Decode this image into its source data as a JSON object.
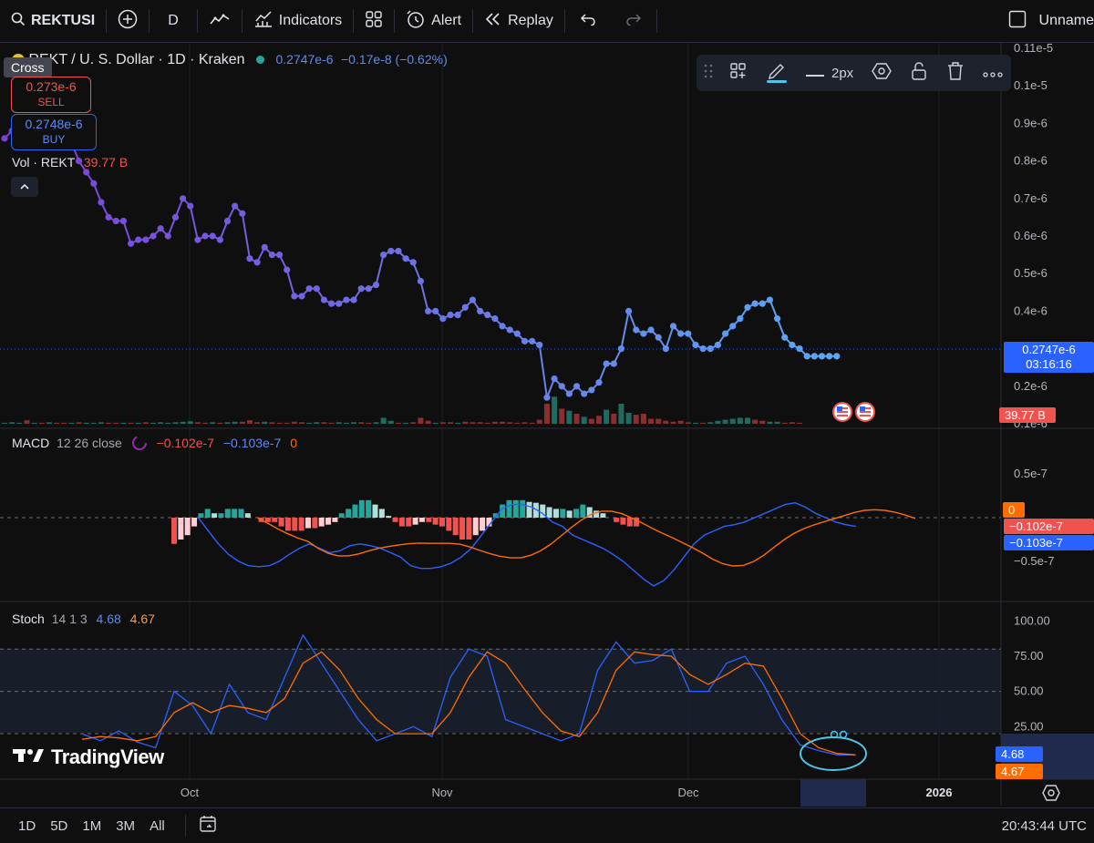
{
  "toolbar": {
    "symbol": "REKTUSI",
    "interval": "D",
    "indicators_label": "Indicators",
    "alert_label": "Alert",
    "replay_label": "Replay",
    "layout_name": "Unname"
  },
  "cursor_mode": "Cross",
  "header": {
    "title": "REKT / U. S. Dollar · 1D · Kraken",
    "last": "0.2747e-6",
    "change": "−0.17e-8 (−0.62%)"
  },
  "trade": {
    "sell_price": "0.273e-6",
    "sell_label": "SELL",
    "buy_price": "0.2748e-6",
    "buy_label": "BUY"
  },
  "vol_legend": {
    "label": "Vol · REKT",
    "value": "39.77 B"
  },
  "drawing_toolbar": {
    "width_label": "2px"
  },
  "price_axis": {
    "ticks": [
      {
        "v": 1.1,
        "label": "0.11e-5"
      },
      {
        "v": 1.0,
        "label": "0.1e-5"
      },
      {
        "v": 0.9,
        "label": "0.9e-6"
      },
      {
        "v": 0.8,
        "label": "0.8e-6"
      },
      {
        "v": 0.7,
        "label": "0.7e-6"
      },
      {
        "v": 0.6,
        "label": "0.6e-6"
      },
      {
        "v": 0.5,
        "label": "0.5e-6"
      },
      {
        "v": 0.4,
        "label": "0.4e-6"
      },
      {
        "v": 0.3,
        "label": "0.3e-6"
      },
      {
        "v": 0.2,
        "label": "0.2e-6"
      },
      {
        "v": 0.1,
        "label": "0.1e-6"
      }
    ],
    "last_label": "0.2747e-6",
    "countdown": "03:16:16",
    "volume_label": "39.77 B"
  },
  "macd_legend": {
    "name": "MACD",
    "params": "12 26 close",
    "v1": "−0.102e-7",
    "v2": "−0.103e-7",
    "v3": "0"
  },
  "macd_axis": {
    "ticks": [
      {
        "v": 0.5,
        "label": "0.5e-7"
      },
      {
        "v": -0.5,
        "label": "−0.5e-7"
      }
    ],
    "hist_label": "0",
    "macd_label": "−0.102e-7",
    "signal_label": "−0.103e-7"
  },
  "stoch_legend": {
    "name": "Stoch",
    "params": "14 1 3",
    "k": "4.68",
    "d": "4.67"
  },
  "stoch_axis": {
    "ticks": [
      {
        "v": 100,
        "label": "100.00"
      },
      {
        "v": 75,
        "label": "75.00"
      },
      {
        "v": 50,
        "label": "50.00"
      },
      {
        "v": 25,
        "label": "25.00"
      }
    ],
    "k_label": "4.68",
    "d_label": "4.67"
  },
  "time_axis": [
    "Oct",
    "Nov",
    "Dec",
    "2026"
  ],
  "watermark": "TradingView",
  "bottom": {
    "ranges": [
      "1D",
      "5D",
      "1M",
      "3M",
      "All"
    ],
    "clock": "20:43:44 UTC"
  },
  "colors": {
    "up": "#26a69a",
    "down": "#ef5350",
    "macd": "#2962ff",
    "signal": "#ff6d00",
    "k": "#2962ff",
    "d": "#ff6d00",
    "line_start": "#7e3fd6",
    "line_end": "#5aa9f5"
  },
  "chart_data": {
    "type": "line",
    "title": "REKT / U. S. Dollar · 1D · Kraken",
    "xlabel": "",
    "ylabel": "",
    "ylim": [
      1e-07,
      1.1e-06
    ],
    "series": [
      {
        "values_e6": [
          0.86,
          0.88,
          0.89,
          0.9,
          0.9,
          0.91,
          0.9,
          0.87,
          0.86,
          0.85,
          0.8,
          0.77,
          0.74,
          0.69,
          0.65,
          0.64,
          0.64,
          0.58,
          0.59,
          0.59,
          0.6,
          0.62,
          0.6,
          0.65,
          0.7,
          0.68,
          0.59,
          0.6,
          0.6,
          0.59,
          0.64,
          0.68,
          0.66,
          0.54,
          0.53,
          0.57,
          0.55,
          0.55,
          0.51,
          0.44,
          0.44,
          0.46,
          0.46,
          0.43,
          0.42,
          0.42,
          0.43,
          0.43,
          0.46,
          0.46,
          0.47,
          0.55,
          0.56,
          0.56,
          0.54,
          0.53,
          0.48,
          0.4,
          0.4,
          0.38,
          0.39,
          0.39,
          0.41,
          0.43,
          0.4,
          0.39,
          0.38,
          0.36,
          0.35,
          0.34,
          0.32,
          0.32,
          0.31,
          0.17,
          0.22,
          0.2,
          0.18,
          0.2,
          0.18,
          0.19,
          0.21,
          0.26,
          0.26,
          0.3,
          0.4,
          0.35,
          0.34,
          0.35,
          0.33,
          0.3,
          0.36,
          0.34,
          0.34,
          0.31,
          0.3,
          0.3,
          0.31,
          0.34,
          0.36,
          0.38,
          0.41,
          0.42,
          0.42,
          0.43,
          0.38,
          0.33,
          0.31,
          0.3,
          0.28,
          0.28,
          0.28,
          0.28,
          0.28
        ]
      }
    ],
    "volume": [
      [
        0.1,
        1
      ],
      [
        0.15,
        1
      ],
      [
        0.1,
        1
      ],
      [
        0.35,
        0
      ],
      [
        0.1,
        1
      ],
      [
        0.1,
        0
      ],
      [
        0.15,
        1
      ],
      [
        0.1,
        0
      ],
      [
        0.1,
        0
      ],
      [
        0.1,
        1
      ],
      [
        0.15,
        0
      ],
      [
        0.1,
        1
      ],
      [
        0.1,
        1
      ],
      [
        0.15,
        1
      ],
      [
        0.1,
        0
      ],
      [
        0.1,
        0
      ],
      [
        0.1,
        1
      ],
      [
        0.1,
        0
      ],
      [
        0.1,
        1
      ],
      [
        0.15,
        0
      ],
      [
        0.1,
        1
      ],
      [
        0.15,
        1
      ],
      [
        0.1,
        1
      ],
      [
        0.15,
        1
      ],
      [
        0.2,
        1
      ],
      [
        0.25,
        1
      ],
      [
        0.15,
        0
      ],
      [
        0.1,
        0
      ],
      [
        0.15,
        1
      ],
      [
        0.1,
        0
      ],
      [
        0.15,
        1
      ],
      [
        0.2,
        1
      ],
      [
        0.2,
        0
      ],
      [
        0.35,
        0
      ],
      [
        0.15,
        0
      ],
      [
        0.2,
        1
      ],
      [
        0.15,
        0
      ],
      [
        0.1,
        0
      ],
      [
        0.1,
        0
      ],
      [
        0.2,
        0
      ],
      [
        0.15,
        0
      ],
      [
        0.1,
        1
      ],
      [
        0.15,
        1
      ],
      [
        0.15,
        0
      ],
      [
        0.1,
        0
      ],
      [
        0.15,
        1
      ],
      [
        0.1,
        1
      ],
      [
        0.15,
        1
      ],
      [
        0.15,
        0
      ],
      [
        0.1,
        0
      ],
      [
        0.15,
        1
      ],
      [
        0.6,
        1
      ],
      [
        0.3,
        1
      ],
      [
        0.1,
        0
      ],
      [
        0.1,
        1
      ],
      [
        0.15,
        0
      ],
      [
        0.6,
        0
      ],
      [
        0.3,
        0
      ],
      [
        0.1,
        1
      ],
      [
        0.15,
        0
      ],
      [
        0.15,
        0
      ],
      [
        0.1,
        1
      ],
      [
        0.2,
        0
      ],
      [
        0.15,
        0
      ],
      [
        0.15,
        0
      ],
      [
        0.1,
        0
      ],
      [
        0.2,
        0
      ],
      [
        0.2,
        0
      ],
      [
        0.15,
        0
      ],
      [
        0.1,
        0
      ],
      [
        0.15,
        0
      ],
      [
        0.1,
        0
      ],
      [
        0.4,
        0
      ],
      [
        2.0,
        0
      ],
      [
        2.7,
        1
      ],
      [
        1.5,
        0
      ],
      [
        1.3,
        1
      ],
      [
        1.0,
        0
      ],
      [
        0.7,
        1
      ],
      [
        0.5,
        0
      ],
      [
        0.8,
        0
      ],
      [
        1.4,
        1
      ],
      [
        1.0,
        0
      ],
      [
        2.0,
        1
      ],
      [
        1.1,
        1
      ],
      [
        0.9,
        0
      ],
      [
        1.0,
        0
      ],
      [
        0.5,
        0
      ],
      [
        0.5,
        0
      ],
      [
        0.3,
        0
      ],
      [
        0.2,
        0
      ],
      [
        0.3,
        0
      ],
      [
        0.15,
        0
      ],
      [
        0.1,
        1
      ],
      [
        0.1,
        0
      ],
      [
        0.15,
        1
      ],
      [
        0.3,
        1
      ],
      [
        0.4,
        1
      ],
      [
        0.5,
        1
      ],
      [
        0.6,
        1
      ],
      [
        0.6,
        1
      ],
      [
        0.4,
        0
      ],
      [
        0.3,
        0
      ],
      [
        0.2,
        1
      ],
      [
        0.2,
        1
      ],
      [
        0.1,
        0
      ],
      [
        0.15,
        0
      ],
      [
        0.1,
        0
      ]
    ],
    "macd_hist_e7": [
      0,
      0,
      0,
      0,
      0,
      0,
      0,
      0,
      0,
      0,
      0,
      0,
      0,
      0,
      0,
      0,
      0,
      0,
      0,
      0,
      0,
      0,
      0,
      0,
      0,
      0,
      0,
      0,
      0,
      0,
      0,
      -0.3,
      -0.25,
      -0.2,
      -0.1,
      0.05,
      0.1,
      0.05,
      0.05,
      0.1,
      0.1,
      0.1,
      0.05,
      0.0,
      -0.05,
      -0.05,
      -0.05,
      -0.1,
      -0.15,
      -0.15,
      -0.15,
      -0.12,
      -0.12,
      -0.1,
      -0.08,
      -0.05,
      0.05,
      0.1,
      0.15,
      0.2,
      0.2,
      0.15,
      0.1,
      0.02,
      -0.05,
      -0.1,
      -0.1,
      -0.08,
      -0.05,
      -0.05,
      -0.08,
      -0.1,
      -0.15,
      -0.2,
      -0.25,
      -0.25,
      -0.2,
      -0.15,
      -0.1,
      0.05,
      0.15,
      0.2,
      0.2,
      0.2,
      0.18,
      0.17,
      0.15,
      0.12,
      0.1,
      0.1,
      0.08,
      0.1,
      0.15,
      0.12,
      0.08,
      0.05,
      0.0,
      -0.05,
      -0.08,
      -0.1,
      -0.1
    ],
    "macd_line_e7": [
      null,
      null,
      null,
      null,
      null,
      null,
      null,
      null,
      null,
      null,
      null,
      null,
      null,
      null,
      0.0,
      -0.15,
      -0.3,
      -0.42,
      -0.5,
      -0.55,
      -0.56,
      -0.55,
      -0.5,
      -0.42,
      -0.35,
      -0.3,
      -0.35,
      -0.4,
      -0.38,
      -0.32,
      -0.3,
      -0.32,
      -0.35,
      -0.4,
      -0.45,
      -0.55,
      -0.58,
      -0.58,
      -0.56,
      -0.52,
      -0.45,
      -0.35,
      -0.2,
      -0.05,
      0.1,
      0.15,
      0.15,
      0.12,
      0.05,
      -0.05,
      -0.1,
      -0.2,
      -0.25,
      -0.3,
      -0.35,
      -0.42,
      -0.5,
      -0.6,
      -0.7,
      -0.78,
      -0.72,
      -0.6,
      -0.45,
      -0.3,
      -0.2,
      -0.15,
      -0.1,
      -0.08,
      -0.05,
      0.0,
      0.05,
      0.1,
      0.15,
      0.17,
      0.12,
      0.05,
      0.0,
      -0.05,
      -0.08,
      -0.1
    ],
    "stoch_k": [
      20,
      15,
      22,
      14,
      10,
      50,
      40,
      20,
      55,
      35,
      30,
      60,
      90,
      70,
      50,
      30,
      15,
      20,
      25,
      18,
      60,
      80,
      75,
      30,
      25,
      20,
      15,
      20,
      65,
      85,
      70,
      72,
      80,
      50,
      50,
      70,
      75,
      55,
      30,
      12,
      8,
      5,
      5
    ],
    "stoch_d": [
      16,
      18,
      17,
      15,
      18,
      35,
      42,
      35,
      40,
      38,
      35,
      45,
      70,
      78,
      65,
      45,
      30,
      20,
      20,
      20,
      35,
      60,
      78,
      70,
      52,
      35,
      22,
      18,
      35,
      65,
      78,
      76,
      75,
      62,
      55,
      62,
      70,
      68,
      45,
      20,
      10,
      6,
      5
    ]
  }
}
